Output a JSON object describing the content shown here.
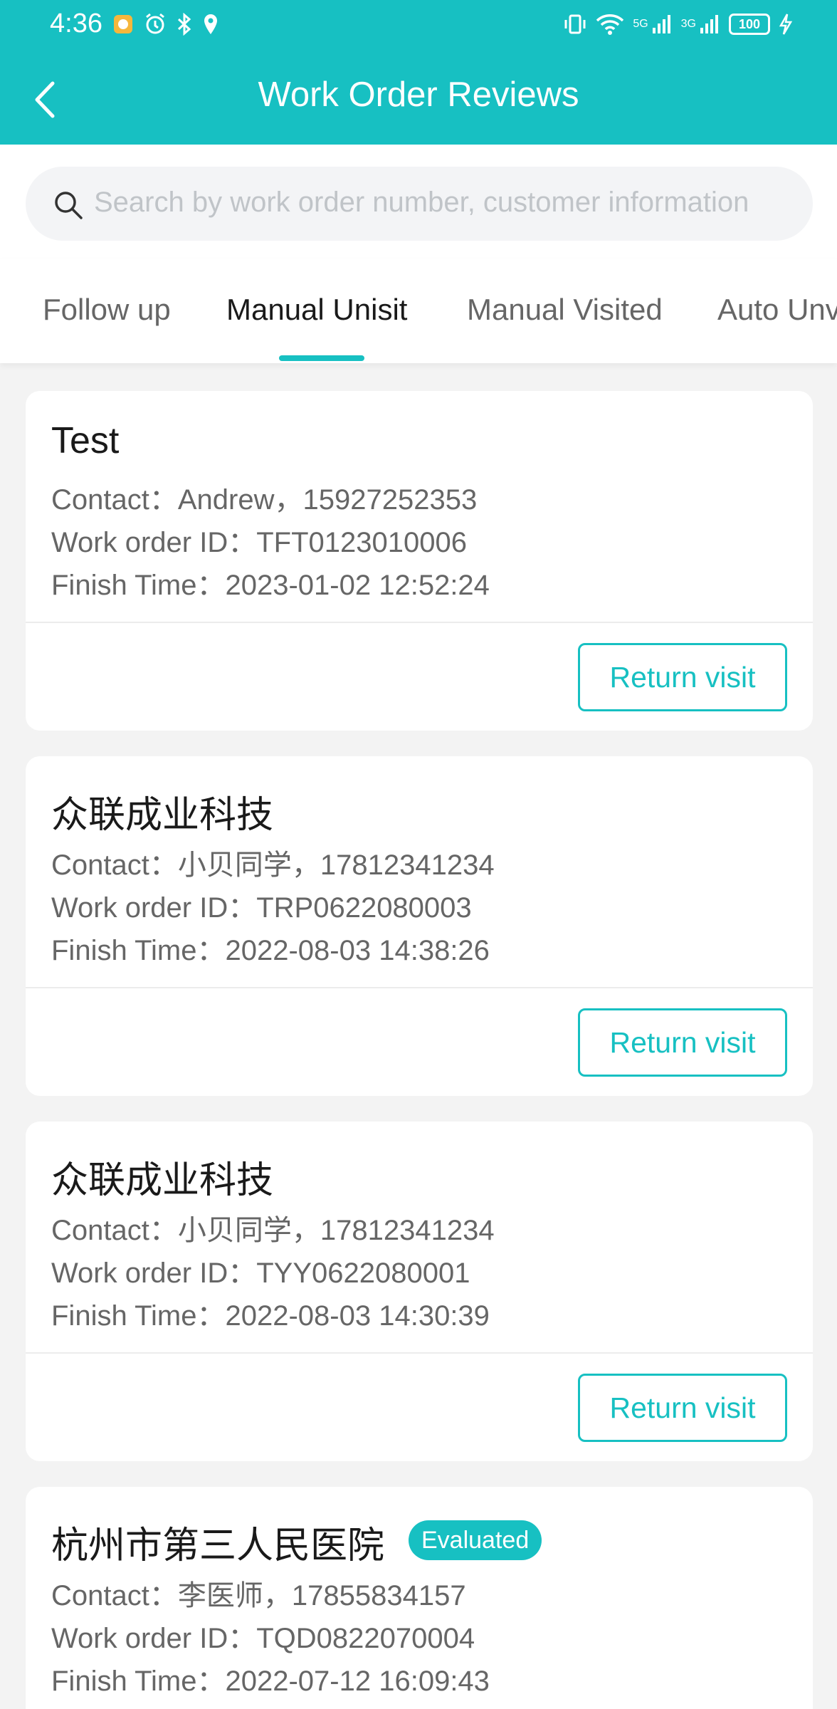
{
  "status_bar": {
    "time": "4:36",
    "battery": "100",
    "net1": "5G",
    "net2": "3G"
  },
  "header": {
    "title": "Work Order Reviews"
  },
  "search": {
    "placeholder": "Search by work order number, customer information"
  },
  "tabs": [
    {
      "label": "Follow up"
    },
    {
      "label": "Manual Unisit"
    },
    {
      "label": "Manual Visited"
    },
    {
      "label": "Auto Unv"
    }
  ],
  "labels": {
    "contact": "Contact：",
    "work_order_id": "Work order ID：",
    "finish_time": "Finish Time："
  },
  "cards": [
    {
      "title": "Test",
      "contact": "Andrew，15927252353",
      "work_order_id": "TFT0123010006",
      "finish_time": "2023-01-02 12:52:24",
      "button": "Return visit"
    },
    {
      "title": "众联成业科技",
      "contact": "小贝同学，17812341234",
      "work_order_id": "TRP0622080003",
      "finish_time": "2022-08-03 14:38:26",
      "button": "Return visit"
    },
    {
      "title": "众联成业科技",
      "contact": "小贝同学，17812341234",
      "work_order_id": "TYY0622080001",
      "finish_time": "2022-08-03 14:30:39",
      "button": "Return visit"
    },
    {
      "title": "杭州市第三人民医院",
      "badge": "Evaluated",
      "contact": "李医师，17855834157",
      "work_order_id": "TQD0822070004",
      "finish_time": "2022-07-12 16:09:43"
    }
  ],
  "colors": {
    "accent": "#17c0c2",
    "background": "#f3f3f3"
  }
}
